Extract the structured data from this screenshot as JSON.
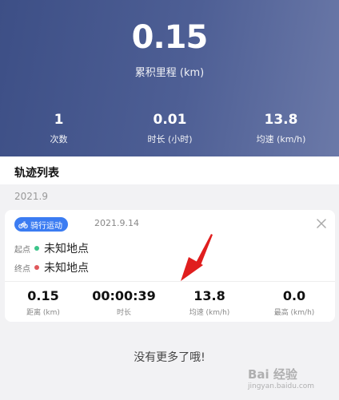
{
  "summary": {
    "total_distance": "0.15",
    "total_distance_label": "累积里程 (km)",
    "stats": [
      {
        "value": "1",
        "label": "次数"
      },
      {
        "value": "0.01",
        "label": "时长 (小时)"
      },
      {
        "value": "13.8",
        "label": "均速 (km/h)"
      }
    ]
  },
  "list": {
    "title": "轨迹列表",
    "month": "2021.9",
    "no_more": "没有更多了哦!"
  },
  "record": {
    "type_tag": "骑行运动",
    "date": "2021.9.14",
    "start_label": "起点",
    "start_place": "未知地点",
    "end_label": "终点",
    "end_place": "未知地点",
    "stats": [
      {
        "value": "0.15",
        "label": "距离 (km)"
      },
      {
        "value": "00:00:39",
        "label": "时长"
      },
      {
        "value": "13.8",
        "label": "均速 (km/h)"
      },
      {
        "value": "0.0",
        "label": "最高 (km/h)"
      }
    ]
  },
  "colors": {
    "hero_start": "#3d4f86",
    "tag_blue": "#3b7cf2",
    "start_dot": "#3cc48a",
    "end_dot": "#e0585b",
    "annotation_arrow": "#e01e1e"
  },
  "icons": {
    "tag": "bicycle-icon",
    "close": "close-icon",
    "annotation": "red-arrow-annotation"
  },
  "watermark": {
    "text": "Bai 经验",
    "url": "jingyan.baidu.com"
  }
}
